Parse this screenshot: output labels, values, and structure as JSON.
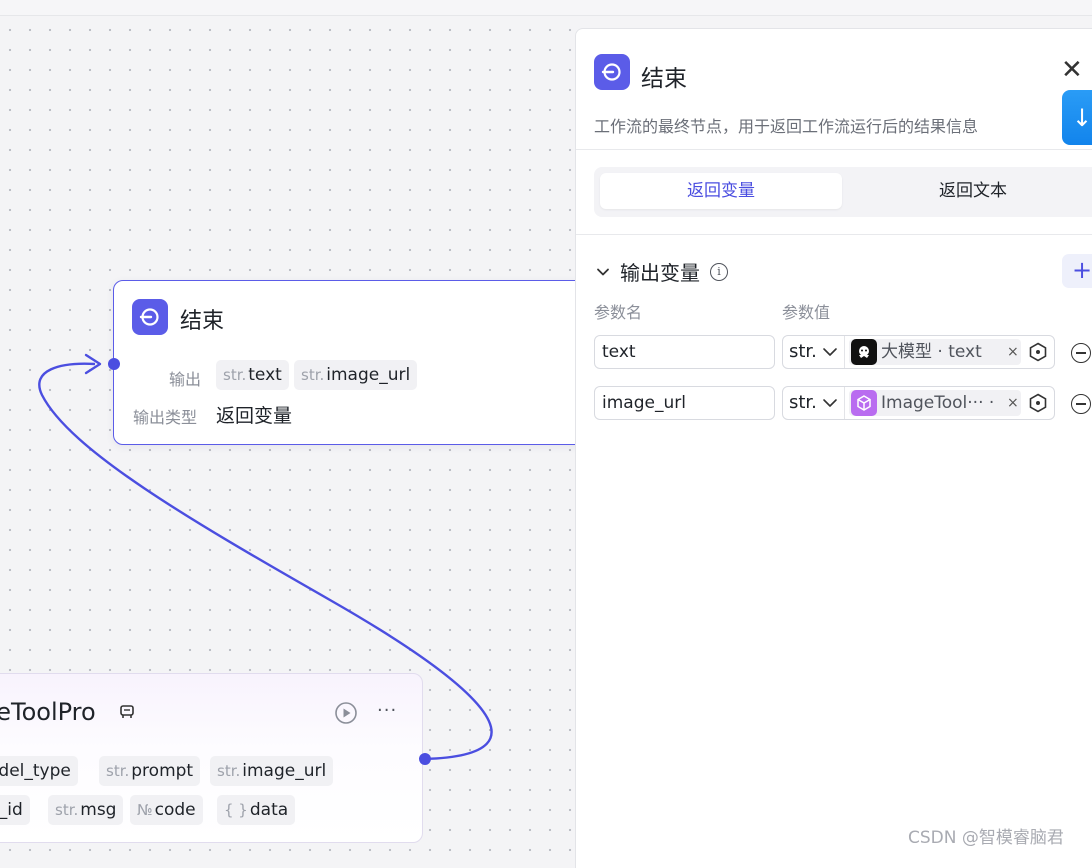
{
  "end_node": {
    "title": "结束",
    "output_label": "输出",
    "outputs": [
      {
        "type": "str.",
        "name": "text"
      },
      {
        "type": "str.",
        "name": "image_url"
      }
    ],
    "output_type_label": "输出类型",
    "output_type_value": "返回变量"
  },
  "tool_node": {
    "title": "geToolPro",
    "inputs": [
      {
        "type": "",
        "name": "odel_type"
      },
      {
        "type": "str.",
        "name": "prompt"
      },
      {
        "type": "str.",
        "name": "image_url"
      }
    ],
    "outputs": [
      {
        "type": "",
        "name": "g_id"
      },
      {
        "type": "str.",
        "name": "msg"
      },
      {
        "type": "№",
        "name": "code"
      },
      {
        "type": "{ }",
        "name": "data"
      }
    ],
    "more_label": "···"
  },
  "panel": {
    "title": "结束",
    "description": "工作流的最终节点，用于返回工作流运行后的结果信息",
    "close_label": "✕",
    "blue_button_label": "↓",
    "tabs": [
      {
        "label": "返回变量",
        "active": true
      },
      {
        "label": "返回文本",
        "active": false
      }
    ],
    "section_title": "输出变量",
    "add_label": "+",
    "col_name": "参数名",
    "col_value": "参数值",
    "params": [
      {
        "name": "text",
        "type": "str.",
        "ref_source": "大模型",
        "ref_text": "大模型 · text",
        "ref_icon_color": "#111111",
        "ref_close": "×"
      },
      {
        "name": "image_url",
        "type": "str.",
        "ref_source": "ImageTool",
        "ref_text": "ImageTool··· ·",
        "ref_icon_color": "#b96cf0",
        "ref_close": "×"
      }
    ]
  },
  "watermark": "CSDN @智模睿脑君",
  "colors": {
    "accent": "#5b5ce8",
    "edge": "#4b4ee0",
    "blue_button": "#1a8cf0"
  }
}
